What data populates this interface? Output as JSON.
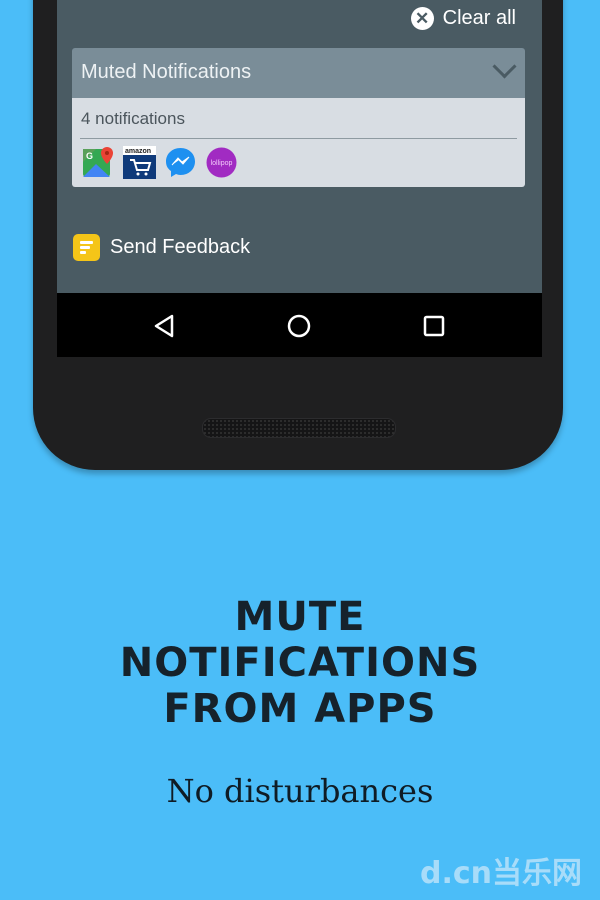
{
  "notification_shade": {
    "clear_all_label": "Clear all",
    "clear_icon": "close-circle-icon",
    "card": {
      "title": "Muted Notifications",
      "toggle_icon": "chevron-down-icon",
      "count_text": "4 notifications",
      "apps": [
        {
          "name": "Google Maps",
          "icon": "google-maps-icon"
        },
        {
          "name": "Amazon",
          "icon": "amazon-icon",
          "label": "amazon"
        },
        {
          "name": "Messenger",
          "icon": "messenger-icon"
        },
        {
          "name": "Lollipop",
          "icon": "lollipop-icon",
          "label": "lollipop"
        }
      ]
    },
    "feedback_label": "Send Feedback"
  },
  "navbar": {
    "back_icon": "back-triangle-icon",
    "home_icon": "home-circle-icon",
    "recents_icon": "recents-square-icon"
  },
  "promo": {
    "headline_lines": [
      "MUTE",
      "NOTIFICATIONS",
      "FROM APPS"
    ],
    "subtitle": "No disturbances"
  },
  "watermark": "d.cn当乐网",
  "colors": {
    "background": "#4bbdf8",
    "screen": "#4a5b63",
    "card_header": "#7a8d98",
    "card_body": "#d8dde3",
    "feedback_icon": "#f5c518"
  }
}
